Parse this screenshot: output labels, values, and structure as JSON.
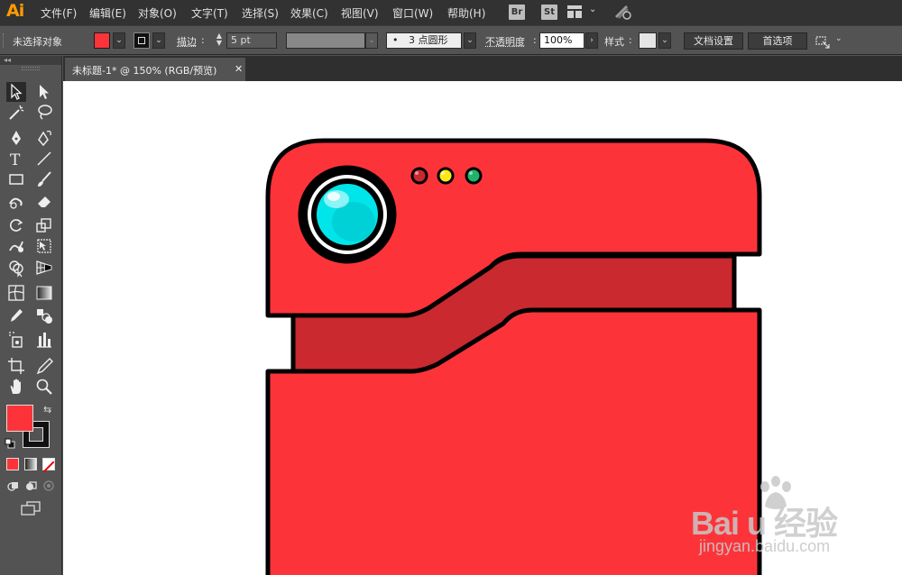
{
  "app": {
    "logo": "Ai"
  },
  "menu": {
    "items": [
      "文件(F)",
      "编辑(E)",
      "对象(O)",
      "文字(T)",
      "选择(S)",
      "效果(C)",
      "视图(V)",
      "窗口(W)",
      "帮助(H)"
    ],
    "bridge_label": "Br",
    "stock_label": "St"
  },
  "control_bar": {
    "selection_status": "未选择对象",
    "stroke_label": "描边",
    "stroke_weight": "5 pt",
    "brush_label": "3 点圆形",
    "opacity_label": "不透明度",
    "opacity_value": "100%",
    "style_label": "样式",
    "doc_setup_button": "文档设置",
    "preferences_button": "首选项",
    "fill_color": "#fc343a",
    "stroke_color": "#000000"
  },
  "document": {
    "tab_title": "未标题-1* @ 150% (RGB/预览)",
    "close_glyph": "✕"
  },
  "toolbox": {
    "collapse_glyph": "◂◂",
    "fill_color": "#fc343a",
    "stroke_color": "#000000"
  },
  "artwork": {
    "body_color": "#fc343a",
    "band_color": "#c9292f",
    "outline_color": "#000000",
    "lens_color": "#00e5ea",
    "led_colors": [
      "#c9292f",
      "#ffe81a",
      "#21b36b"
    ]
  },
  "watermark": {
    "logo_text": "Bai  u 经验",
    "url": "jingyan.baidu.com"
  }
}
